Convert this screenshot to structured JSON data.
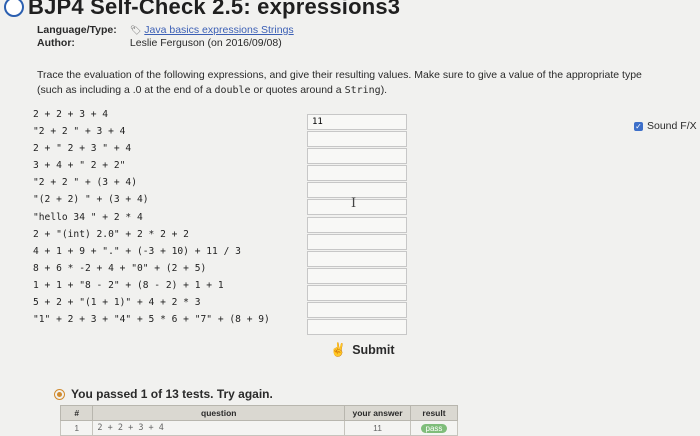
{
  "header": {
    "title": "BJP4 Self-Check 2.5: expressions3"
  },
  "meta": {
    "language_label": "Language/Type:",
    "language_icon": "tag-icon",
    "language_value": "Java basics expressions Strings",
    "author_label": "Author:",
    "author_value": "Leslie Ferguson (on 2016/09/08)"
  },
  "description": {
    "line1_pre": "Trace the evaluation of the following expressions, and give their resulting values. Make sure to give a value of the appropriate type",
    "line2_pre": "(such as including a .0 at the end of a ",
    "double_word": "double",
    "line2_mid": " or quotes around a ",
    "string_word": "String",
    "line2_end": ")."
  },
  "expressions": [
    "2 + 2 + 3 + 4",
    "\"2 + 2 \" + 3 + 4",
    "2 + \" 2 + 3 \" + 4",
    "3 + 4 + \" 2 + 2\"",
    "\"2 + 2 \" + (3 + 4)",
    "\"(2 + 2) \" + (3 + 4)",
    "\"hello 34 \" + 2 * 4",
    "2 + \"(int) 2.0\" + 2 * 2 + 2",
    "4 + 1 + 9 + \".\" + (-3 + 10) + 11 / 3",
    "8 + 6 * -2 + 4 + \"0\" + (2 + 5)",
    "1 + 1 + \"8 - 2\" + (8 - 2) + 1 + 1",
    "5 + 2 + \"(1 + 1)\" + 4 + 2 * 3",
    "\"1\" + 2 + 3 + \"4\" + 5 * 6 + \"7\" + (8 + 9)"
  ],
  "answers": [
    "11",
    "",
    "",
    "",
    "",
    "",
    "",
    "",
    "",
    "",
    "",
    "",
    ""
  ],
  "sound": {
    "label": "Sound F/X",
    "checked": true
  },
  "submit": {
    "label": "Submit",
    "icon": "pointer-hand-icon"
  },
  "status": {
    "message": "You passed 1 of 13 tests. Try again.",
    "icon": "warning-circle-icon"
  },
  "results_table": {
    "columns": [
      "#",
      "question",
      "your answer",
      "result"
    ],
    "rows": [
      {
        "num": "1",
        "question": "2 + 2 + 3 + 4",
        "answer": "11",
        "result": "pass"
      }
    ]
  }
}
